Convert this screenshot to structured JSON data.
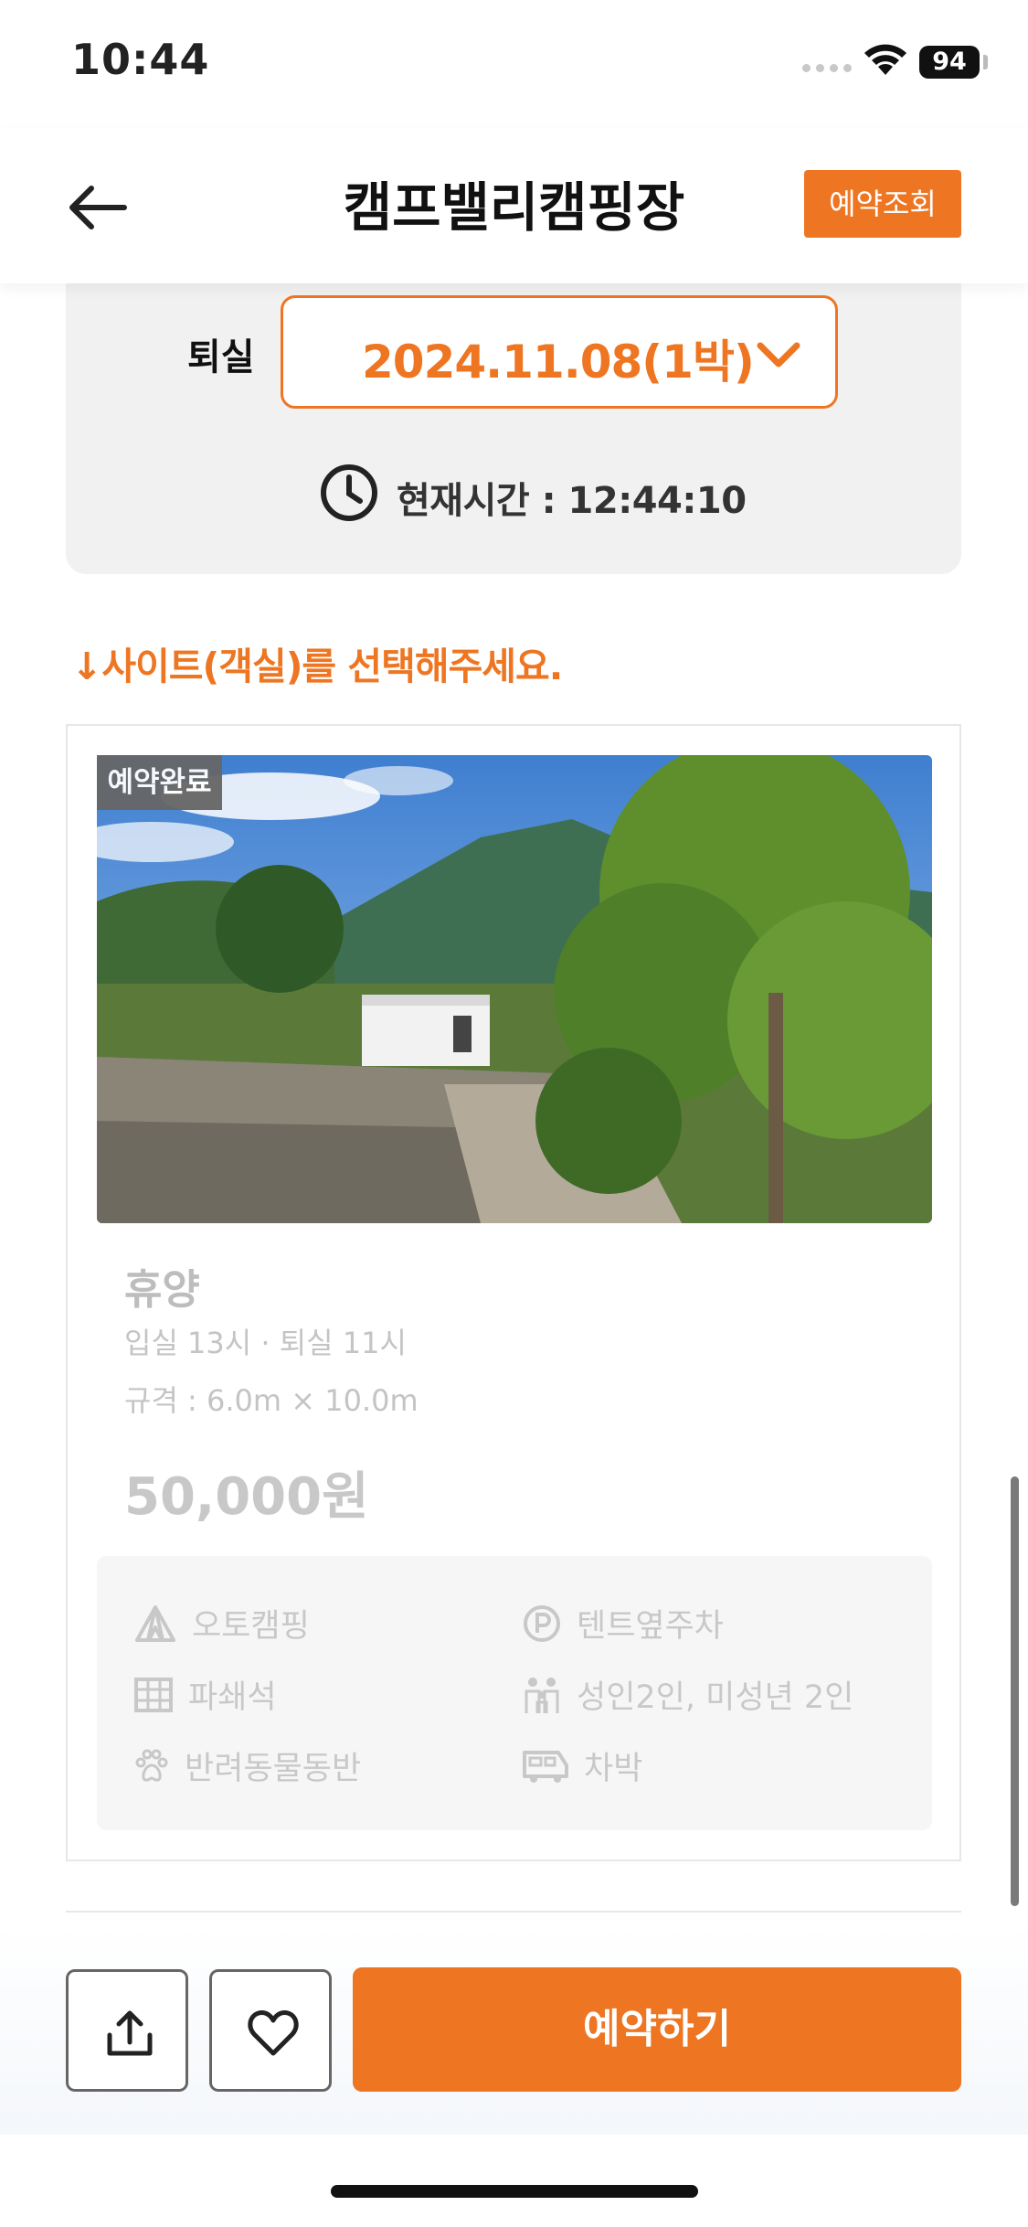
{
  "status_bar": {
    "time": "10:44",
    "battery": "94"
  },
  "header": {
    "title": "캠프밸리캠핑장",
    "lookup_label": "예약조회"
  },
  "date_card": {
    "checkout_label": "퇴실",
    "checkout_value": "2024.11.08(1박)",
    "current_time": "현재시간 : 12:44:10"
  },
  "site_prompt": "↓사이트(객실)를 선택해주세요.",
  "site": {
    "badge": "예약완료",
    "name": "휴양",
    "times": "입실 13시 · 퇴실 11시",
    "size": "규격 : 6.0m × 10.0m",
    "price": "50,000원",
    "amenities": {
      "camping": "오토캠핑",
      "parking": "텐트옆주차",
      "ground": "파쇄석",
      "people": "성인2인, 미성년 2인",
      "pets": "반려동물동반",
      "carcamp": "차박"
    }
  },
  "bottom": {
    "reserve_label": "예약하기"
  },
  "colors": {
    "accent": "#ee7622",
    "muted": "#c8c8c8",
    "card_bg": "#f1f1f1"
  },
  "icons": [
    "back-arrow-icon",
    "chevron-down-icon",
    "clock-icon",
    "tent-icon",
    "parking-icon",
    "grid-icon",
    "people-icon",
    "paw-icon",
    "camper-van-icon",
    "share-icon",
    "heart-icon",
    "wifi-icon"
  ]
}
